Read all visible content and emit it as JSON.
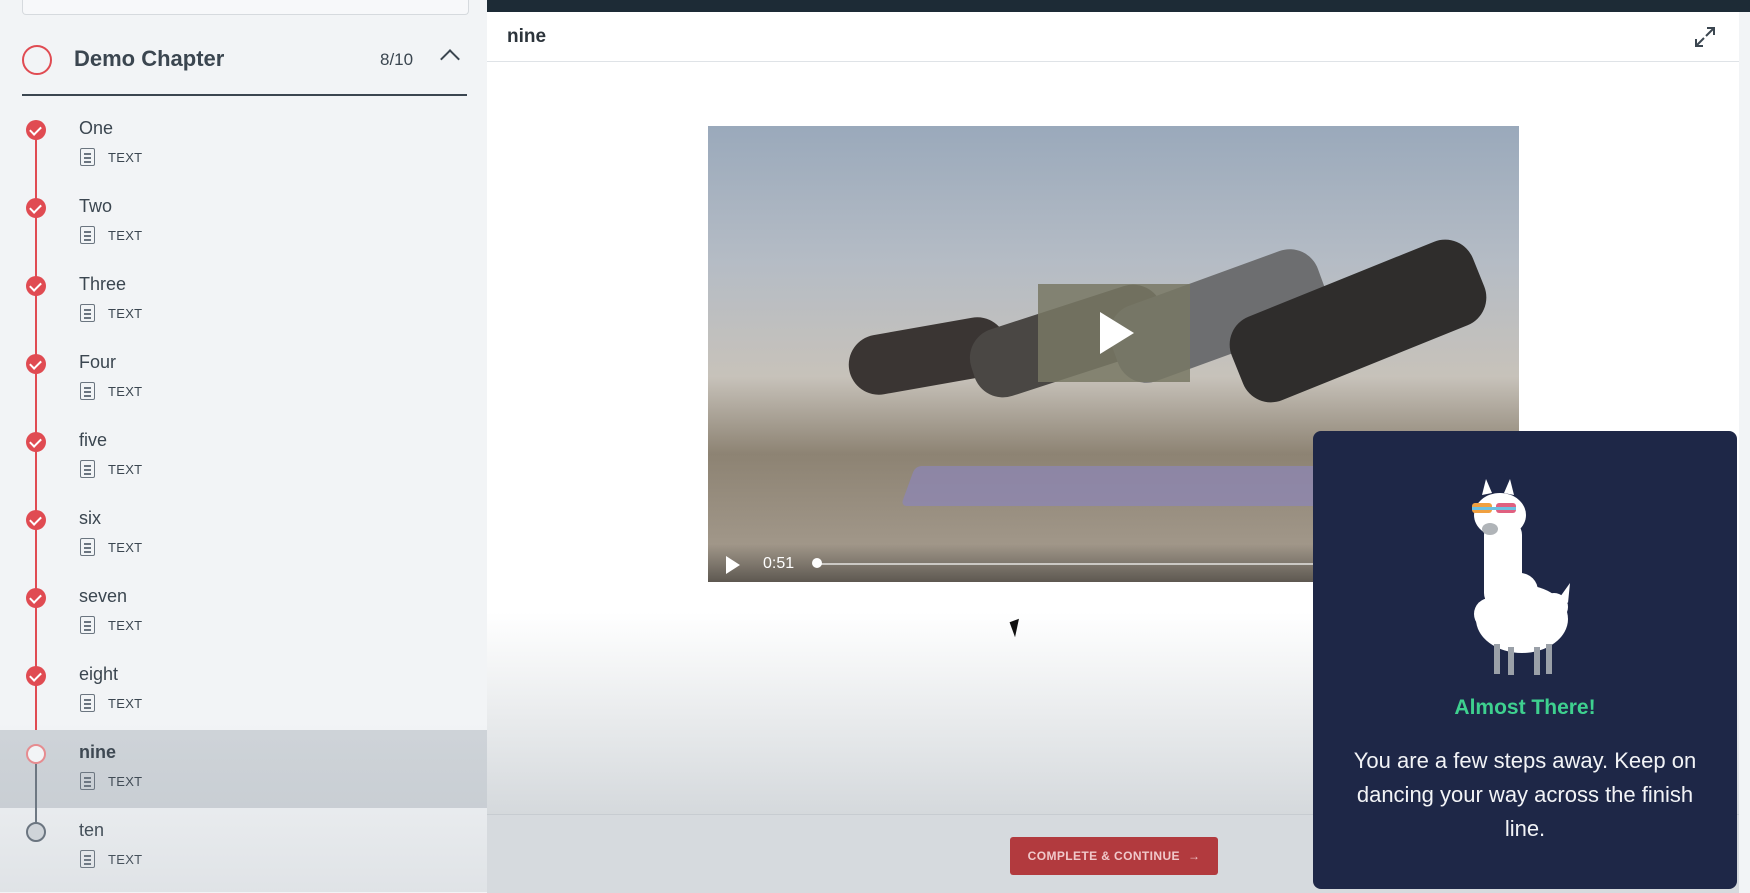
{
  "sidebar": {
    "chapter": {
      "title": "Demo Chapter",
      "progress": "8/10"
    },
    "lessons": [
      {
        "title": "One",
        "type": "TEXT",
        "completed": true
      },
      {
        "title": "Two",
        "type": "TEXT",
        "completed": true
      },
      {
        "title": "Three",
        "type": "TEXT",
        "completed": true
      },
      {
        "title": "Four",
        "type": "TEXT",
        "completed": true
      },
      {
        "title": "five",
        "type": "TEXT",
        "completed": true
      },
      {
        "title": "six",
        "type": "TEXT",
        "completed": true
      },
      {
        "title": "seven",
        "type": "TEXT",
        "completed": true
      },
      {
        "title": "eight",
        "type": "TEXT",
        "completed": true
      },
      {
        "title": "nine",
        "type": "TEXT",
        "completed": false,
        "active": true
      },
      {
        "title": "ten",
        "type": "TEXT",
        "completed": false
      }
    ]
  },
  "main": {
    "lesson_title": "nine",
    "video": {
      "time": "0:51"
    },
    "complete_button": "COMPLETE & CONTINUE",
    "complete_arrow": "→"
  },
  "popup": {
    "title": "Almost There!",
    "message": "You are a few steps away. Keep on dancing your way across the finish line."
  },
  "colors": {
    "accent": "#e04b52",
    "popup_bg": "#1e2747",
    "popup_title": "#3ed08f",
    "button": "#b23a3e"
  }
}
